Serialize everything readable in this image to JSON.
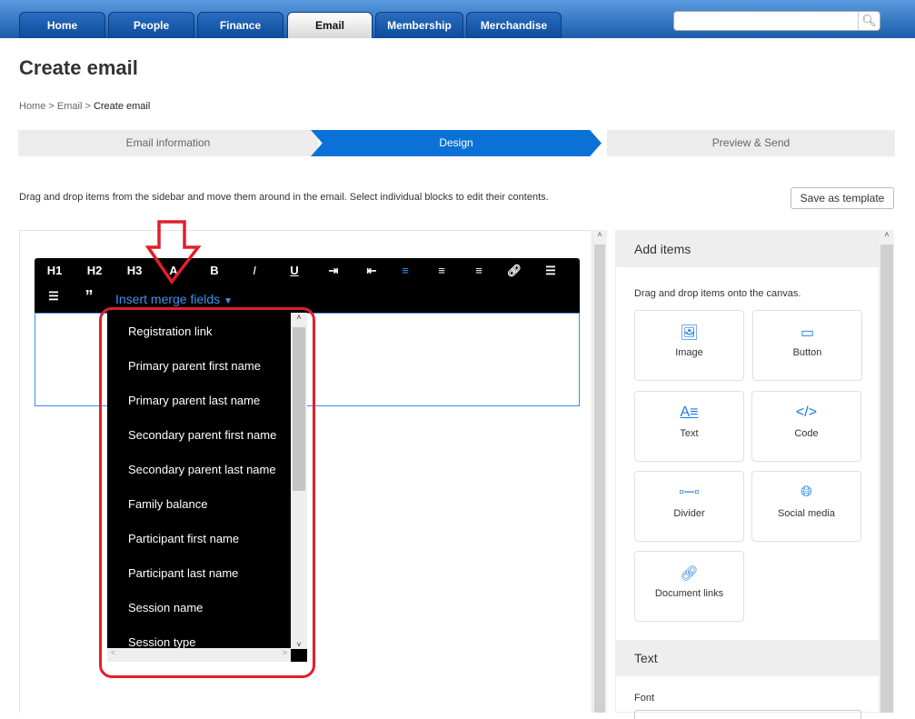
{
  "nav": {
    "tabs": [
      "Home",
      "People",
      "Finance",
      "Email",
      "Membership",
      "Merchandise"
    ],
    "active": "Email",
    "search_value": ""
  },
  "page": {
    "title": "Create email",
    "breadcrumb": [
      "Home",
      "Email",
      "Create email"
    ],
    "steps": [
      "Email information",
      "Design",
      "Preview & Send"
    ],
    "active_step": "Design",
    "instructions": "Drag and drop items from the sidebar and move them around in the email. Select individual blocks to edit their contents.",
    "save_template": "Save as template"
  },
  "toolbar": {
    "buttons": [
      "H1",
      "H2",
      "H3",
      "A",
      "B",
      "I",
      "U"
    ],
    "merge_fields_label": "Insert merge fields"
  },
  "merge_fields": [
    "Registration link",
    "Primary parent first name",
    "Primary parent last name",
    "Secondary parent first name",
    "Secondary parent last name",
    "Family balance",
    "Participant first name",
    "Participant last name",
    "Session name",
    "Session type"
  ],
  "sidebar": {
    "add_items_title": "Add items",
    "hint": "Drag and drop items onto the canvas.",
    "items": [
      "Image",
      "Button",
      "Text",
      "Code",
      "Divider",
      "Social media",
      "Document links"
    ],
    "text_section_title": "Text",
    "font_label": "Font"
  },
  "colors": {
    "accent": "#0a72d6",
    "annotation": "#e0202a"
  }
}
